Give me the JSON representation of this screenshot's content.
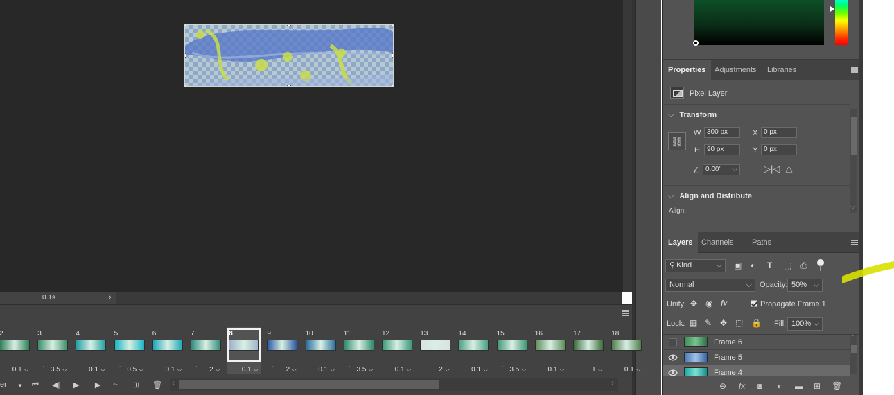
{
  "canvas": {
    "status_delay": "0.1s"
  },
  "timeline": {
    "loop_fragment": "er",
    "frames": [
      {
        "num": "2",
        "delay": "0.1",
        "thumb_color": "#2e7f57"
      },
      {
        "num": "3",
        "delay": "3.5",
        "thumb_color": "#3c8f6a"
      },
      {
        "num": "4",
        "delay": "0.1",
        "thumb_color": "#1f9ea3"
      },
      {
        "num": "5",
        "delay": "0.5",
        "thumb_color": "#17b6c4"
      },
      {
        "num": "6",
        "delay": "0.1",
        "thumb_color": "#1aa8b9"
      },
      {
        "num": "7",
        "delay": "2",
        "thumb_color": "#2f8c7a"
      },
      {
        "num": "8",
        "delay": "0.1",
        "thumb_color": "#9db3c9"
      },
      {
        "num": "9",
        "delay": "2",
        "thumb_color": "#2c59a4"
      },
      {
        "num": "10",
        "delay": "0.1",
        "thumb_color": "#2a6fa0"
      },
      {
        "num": "11",
        "delay": "3.5",
        "thumb_color": "#2f8b6f"
      },
      {
        "num": "12",
        "delay": "0.1",
        "thumb_color": "#3b9a79"
      },
      {
        "num": "13",
        "delay": "2",
        "thumb_color": "#d9e2e0"
      },
      {
        "num": "14",
        "delay": "0.1",
        "thumb_color": "#4aa080"
      },
      {
        "num": "15",
        "delay": "3.5",
        "thumb_color": "#3f9776"
      },
      {
        "num": "16",
        "delay": "0.1",
        "thumb_color": "#5e8d5a"
      },
      {
        "num": "17",
        "delay": "1",
        "thumb_color": "#3c6b3a"
      },
      {
        "num": "18",
        "delay": "0.1",
        "thumb_color": "#4f7d4c"
      }
    ]
  },
  "properties": {
    "tabs": [
      "Properties",
      "Adjustments",
      "Libraries"
    ],
    "layer_type": "Pixel Layer",
    "transform_title": "Transform",
    "w_label": "W",
    "w_value": "300 px",
    "h_label": "H",
    "h_value": "90 px",
    "x_label": "X",
    "x_value": "0 px",
    "y_label": "Y",
    "y_value": "0 px",
    "angle_value": "0.00°",
    "align_title": "Align and Distribute",
    "align_label": "Align:"
  },
  "layers": {
    "tabs": [
      "Layers",
      "Channels",
      "Paths"
    ],
    "kind_label": "Kind",
    "blend_mode": "Normal",
    "opacity_label": "Opacity:",
    "opacity_value": "50%",
    "unify_label": "Unify:",
    "propagate_label": "Propagate Frame 1",
    "lock_label": "Lock:",
    "fill_label": "Fill:",
    "fill_value": "100%",
    "rows": [
      {
        "name": "Frame 6",
        "visible": false
      },
      {
        "name": "Frame 5",
        "visible": true
      },
      {
        "name": "Frame 4",
        "visible": true
      }
    ]
  },
  "colors": {
    "accent_highlight": "#d8e000"
  }
}
